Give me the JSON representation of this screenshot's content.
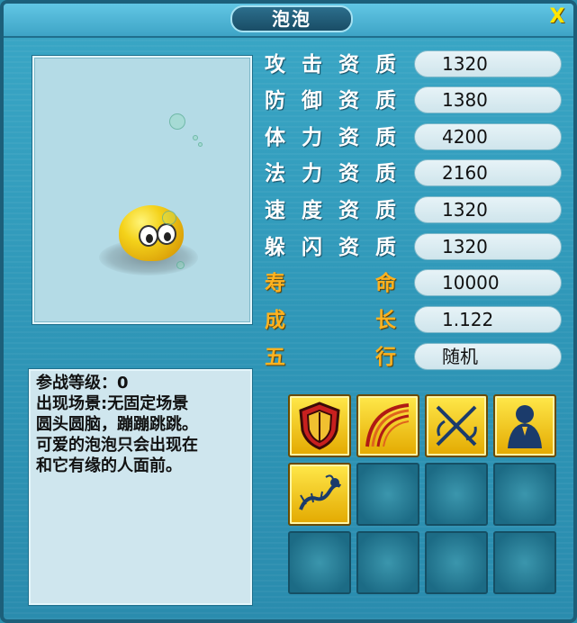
{
  "window": {
    "title": "泡泡",
    "close_label": "X"
  },
  "stats": [
    {
      "label": "攻击资质",
      "value": "1320",
      "highlight": false
    },
    {
      "label": "防御资质",
      "value": "1380",
      "highlight": false
    },
    {
      "label": "体力资质",
      "value": "4200",
      "highlight": false
    },
    {
      "label": "法力资质",
      "value": "2160",
      "highlight": false
    },
    {
      "label": "速度资质",
      "value": "1320",
      "highlight": false
    },
    {
      "label": "躲闪资质",
      "value": "1320",
      "highlight": false
    },
    {
      "label": "寿命",
      "value": "10000",
      "highlight": true
    },
    {
      "label": "成长",
      "value": "1.122",
      "highlight": true
    },
    {
      "label": "五行",
      "value": "随机",
      "highlight": true
    }
  ],
  "description": {
    "level_line": "参战等级：0",
    "scene_line": "出现场景:无固定场景",
    "line3": "圆头圆脑，蹦蹦跳跳。",
    "line4": "可爱的泡泡只会出现在",
    "line5": "和它有缘的人面前。"
  },
  "skills": [
    {
      "icon": "shield-icon",
      "filled": true
    },
    {
      "icon": "bow-icon",
      "filled": true
    },
    {
      "icon": "crossed-swords-icon",
      "filled": true
    },
    {
      "icon": "hooded-figure-icon",
      "filled": true
    },
    {
      "icon": "dragon-icon",
      "filled": true
    },
    {
      "icon": "",
      "filled": false
    },
    {
      "icon": "",
      "filled": false
    },
    {
      "icon": "",
      "filled": false
    },
    {
      "icon": "",
      "filled": false
    },
    {
      "icon": "",
      "filled": false
    },
    {
      "icon": "",
      "filled": false
    },
    {
      "icon": "",
      "filled": false
    }
  ],
  "colors": {
    "panel": "#2f97b8",
    "gold_label": "#ffb21f",
    "value_box": "#dcecf1",
    "skill_gold": "#f2c200"
  }
}
